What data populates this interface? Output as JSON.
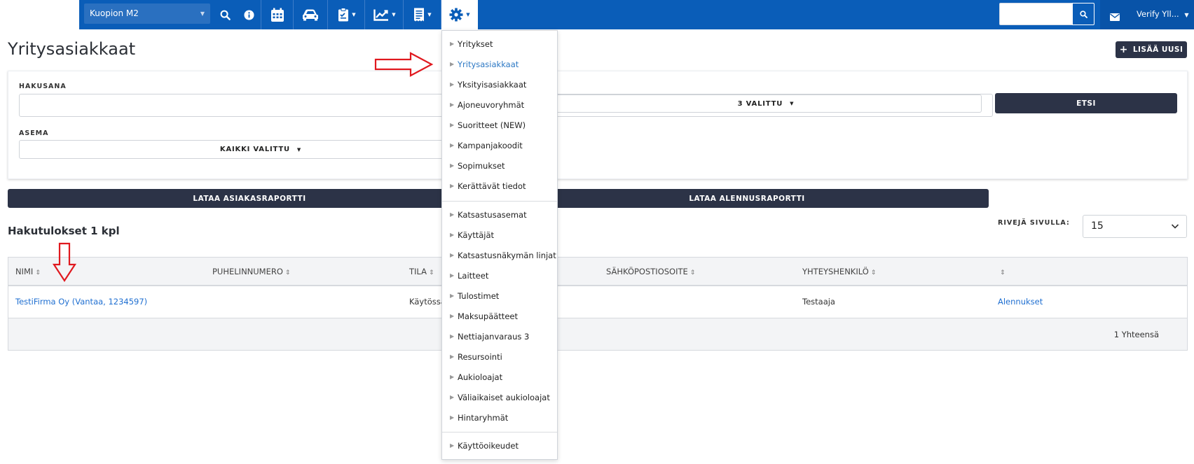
{
  "topbar": {
    "station": "Kuopion M2",
    "user": "Verify Yll...",
    "icons": [
      "search-icon",
      "info-icon",
      "calendar-icon",
      "car-icon",
      "clipboard-icon",
      "chart-icon",
      "receipt-icon",
      "gear-icon",
      "mail-icon"
    ],
    "accent": "#0a5db8"
  },
  "page": {
    "title": "Yritysasiakkaat",
    "add_new": "LISÄÄ UUSI"
  },
  "search": {
    "keyword_label": "HAKUSANA",
    "keyword_value": "",
    "status_select": "3 VALITTU",
    "station_label": "ASEMA",
    "station_select": "KAIKKI VALITTU",
    "search_button": "ETSI"
  },
  "reports": {
    "customer_report": "LATAA ASIAKASRAPORTTI",
    "discount_report": "LATAA ALENNUSRAPORTTI"
  },
  "results": {
    "title": "Hakutulokset 1 kpl",
    "rows_label": "RIVEJÄ SIVULLA:",
    "rows_value": "15",
    "columns": [
      "NIMI",
      "PUHELINNUMERO",
      "TILA",
      "SÄHKÖPOSTIOSOITE",
      "YHTEYSHENKILÖ",
      ""
    ],
    "rows": [
      {
        "name": "TestiFirma Oy (Vantaa, 1234597)",
        "phone": "",
        "status": "Käytössä",
        "email": "",
        "contact": "Testaaja",
        "action": "Alennukset"
      }
    ],
    "total": "1 Yhteensä"
  },
  "menu": {
    "group1": [
      "Yritykset",
      "Yritysasiakkaat",
      "Yksityisasiakkaat",
      "Ajoneuvoryhmät",
      "Suoritteet (NEW)",
      "Kampanjakoodit",
      "Sopimukset",
      "Kerättävät tiedot"
    ],
    "group2": [
      "Katsastusasemat",
      "Käyttäjät",
      "Katsastusnäkymän linjat",
      "Laitteet",
      "Tulostimet",
      "Maksupäätteet",
      "Nettiajanvaraus 3",
      "Resursointi",
      "Aukioloajat",
      "Väliaikaiset aukioloajat",
      "Hintaryhmät"
    ],
    "group3": [
      "Käyttöoikeudet"
    ],
    "active": "Yritysasiakkaat"
  }
}
